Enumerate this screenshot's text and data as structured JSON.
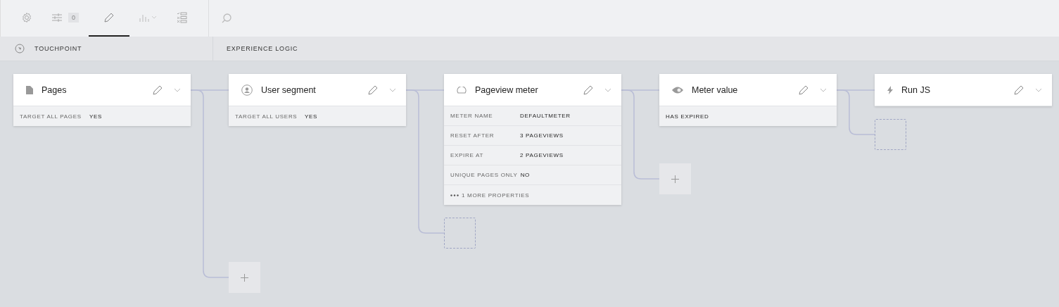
{
  "toolbar": {
    "tabs": [
      {
        "kind": "settings",
        "selected": false
      },
      {
        "kind": "filters",
        "selected": false,
        "badge": "0"
      },
      {
        "kind": "edit",
        "selected": true
      },
      {
        "kind": "chart",
        "selected": false
      },
      {
        "kind": "checklist",
        "selected": false
      }
    ]
  },
  "section_headers": [
    {
      "kind": "touchpoint",
      "label": "TOUCHPOINT"
    },
    {
      "kind": "logic",
      "label": "EXPERIENCE LOGIC"
    }
  ],
  "nodes": [
    {
      "kind": "page",
      "title": "Pages",
      "properties": [
        {
          "label": "TARGET ALL PAGES",
          "value": "YES"
        }
      ],
      "branch": {
        "kind": "add"
      }
    },
    {
      "kind": "user",
      "title": "User segment",
      "properties": [
        {
          "label": "TARGET ALL USERS",
          "value": "YES"
        }
      ],
      "branch": {
        "kind": "drop"
      }
    },
    {
      "kind": "meter",
      "title": "Pageview meter",
      "properties": [
        {
          "label": "METER NAME",
          "value": "DEFAULTMETER"
        },
        {
          "label": "RESET AFTER",
          "value": "3 PAGEVIEWS"
        },
        {
          "label": "EXPIRE AT",
          "value": "2 PAGEVIEWS"
        },
        {
          "label": "UNIQUE PAGES ONLY",
          "value": "NO"
        }
      ],
      "more": "1 MORE PROPERTIES",
      "branch": {
        "kind": "add"
      }
    },
    {
      "kind": "eye",
      "title": "Meter value",
      "properties": [
        {
          "label": "HAS EXPIRED"
        }
      ],
      "branch": {
        "kind": "drop"
      }
    },
    {
      "kind": "bolt",
      "title": "Run JS"
    }
  ]
}
